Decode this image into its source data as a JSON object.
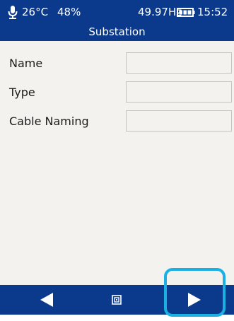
{
  "status_bar": {
    "mic_icon": "microphone-icon",
    "temperature": "26°C",
    "humidity": "48%",
    "frequency": "49.97Hz",
    "battery_icon": "battery-icon",
    "time": "15:52"
  },
  "header": {
    "title": "Substation"
  },
  "fields": [
    {
      "label": "Name",
      "value": ""
    },
    {
      "label": "Type",
      "value": ""
    },
    {
      "label": "Cable Naming",
      "value": ""
    }
  ],
  "footer": {
    "back_icon": "triangle-left-icon",
    "home_icon": "square-menu-icon",
    "next_icon": "triangle-right-icon"
  },
  "colors": {
    "header_bg": "#0b3a8c",
    "content_bg": "#f3f2ee",
    "highlight": "#1ab0e3"
  }
}
